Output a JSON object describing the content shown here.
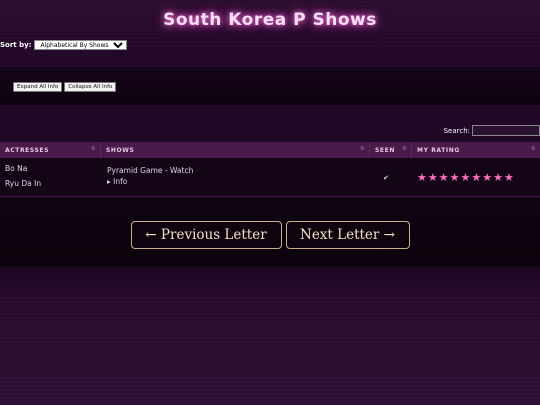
{
  "page": {
    "title": "South Korea P Shows"
  },
  "sort": {
    "label": "Sort by:",
    "selected": "Alphabetical By Shows"
  },
  "controls": {
    "expand_label": "Expand All Info",
    "collapse_label": "Collapse All Info"
  },
  "search": {
    "label": "Search:",
    "value": ""
  },
  "table": {
    "headers": [
      "ACTRESSES",
      "SHOWS",
      "SEEN",
      "MY RATING"
    ],
    "rows": [
      {
        "actresses": [
          "Bo Na",
          "Ryu Da In"
        ],
        "show": "Pyramid Game - Watch",
        "info": "▸ Info",
        "seen": "✔",
        "rating": 9
      }
    ]
  },
  "nav": {
    "prev": "← Previous Letter",
    "next": "Next Letter →"
  },
  "colors": {
    "accent": "#ff6fbf",
    "title_glow": "#ff6fd8",
    "header_bg": "#4a1a4a",
    "button_border": "#cdb08b"
  },
  "icons": {
    "star": "star-icon",
    "check": "check-icon",
    "sort": "sort-icon"
  }
}
